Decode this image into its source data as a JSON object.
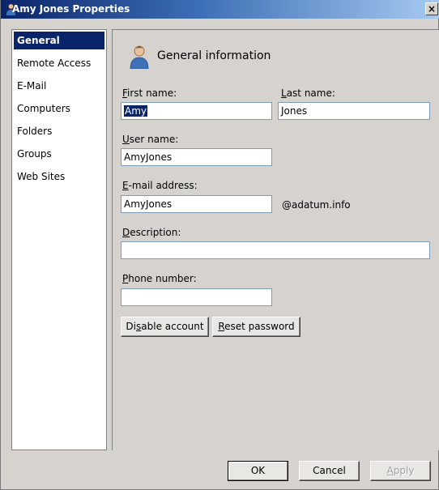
{
  "window": {
    "title": "Amy Jones Properties",
    "close_glyph": "×",
    "icon": "user-icon"
  },
  "nav": {
    "items": [
      {
        "label": "General",
        "selected": true
      },
      {
        "label": "Remote Access"
      },
      {
        "label": "E-Mail"
      },
      {
        "label": "Computers"
      },
      {
        "label": "Folders"
      },
      {
        "label": "Groups"
      },
      {
        "label": "Web Sites"
      }
    ]
  },
  "panel": {
    "header": "General information",
    "header_icon": "user-icon",
    "first_name": {
      "mnemonic": "F",
      "rest": "irst name:",
      "value": "Amy"
    },
    "last_name": {
      "mnemonic": "L",
      "rest": "ast name:",
      "value": "Jones"
    },
    "user_name": {
      "mnemonic": "U",
      "rest": "ser name:",
      "value": "AmyJones"
    },
    "email": {
      "mnemonic": "E",
      "rest": "-mail address:",
      "value": "AmyJones",
      "suffix": "@adatum.info"
    },
    "description": {
      "mnemonic": "D",
      "rest": "escription:",
      "value": ""
    },
    "phone": {
      "mnemonic": "P",
      "rest": "hone number:",
      "value": ""
    },
    "disable_button": {
      "pre": "Di",
      "mnemonic": "s",
      "post": "able account"
    },
    "reset_button": {
      "mnemonic": "R",
      "rest": "eset password"
    }
  },
  "footer": {
    "ok": "OK",
    "cancel": "Cancel",
    "apply": {
      "mnemonic": "A",
      "rest": "pply",
      "enabled": false
    }
  },
  "colors": {
    "selection": "#0a246a",
    "dialog_bg": "#d6d3ce",
    "title_start": "#0a246a",
    "title_end": "#a6caf0"
  }
}
